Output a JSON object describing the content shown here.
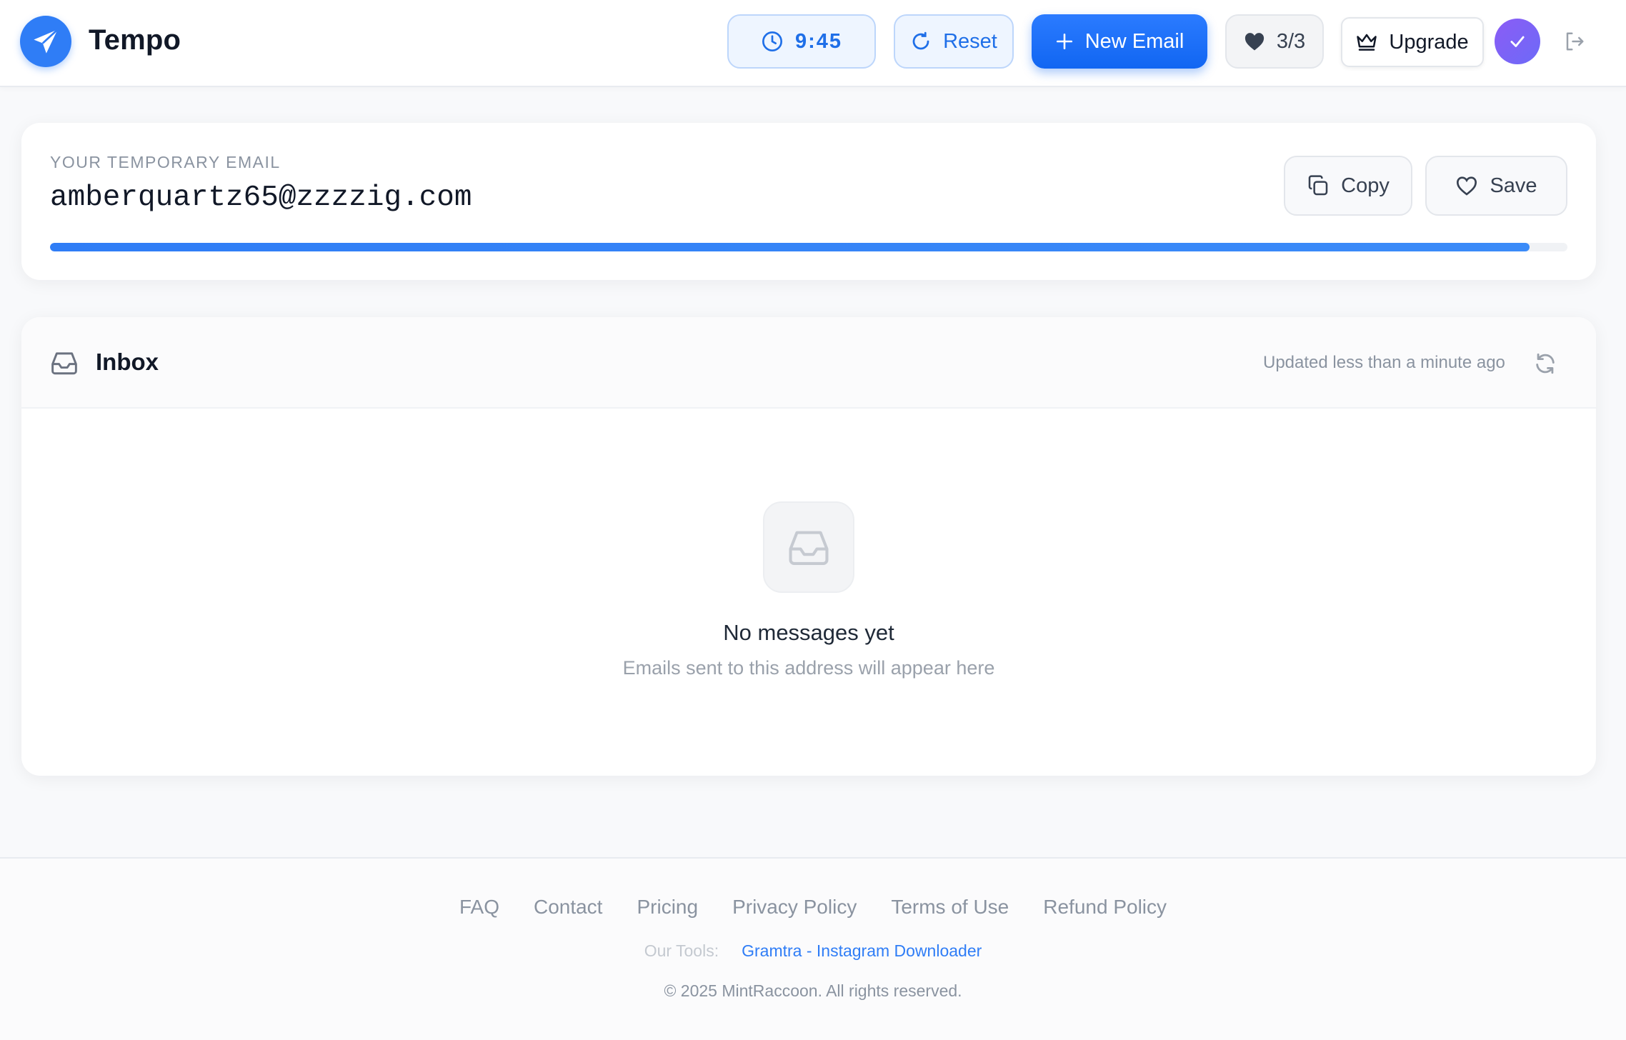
{
  "header": {
    "brand": "Tempo",
    "timer": "9:45",
    "reset_label": "Reset",
    "new_email_label": "New Email",
    "favorites_count": "3/3",
    "upgrade_label": "Upgrade",
    "icons": {
      "logo": "paper-plane-icon",
      "timer": "clock-icon",
      "reset": "rotate-icon",
      "new": "plus-icon",
      "favorites": "heart-icon",
      "upgrade": "crown-icon",
      "avatar": "check-icon",
      "logout": "logout-icon"
    },
    "colors": {
      "accent": "#2f7df6",
      "avatar": "#8b5cf6"
    }
  },
  "email_card": {
    "label": "YOUR TEMPORARY EMAIL",
    "address": "amberquartz65@zzzzig.com",
    "copy_label": "Copy",
    "save_label": "Save",
    "time_remaining_fraction": 0.975
  },
  "inbox": {
    "title": "Inbox",
    "updated": "Updated less than a minute ago",
    "empty_title": "No messages yet",
    "empty_subtitle": "Emails sent to this address will appear here"
  },
  "footer": {
    "links": [
      "FAQ",
      "Contact",
      "Pricing",
      "Privacy Policy",
      "Terms of Use",
      "Refund Policy"
    ],
    "tools_label": "Our Tools:",
    "tools_link": "Gramtra - Instagram Downloader",
    "copyright": "© 2025 MintRaccoon. All rights reserved."
  }
}
